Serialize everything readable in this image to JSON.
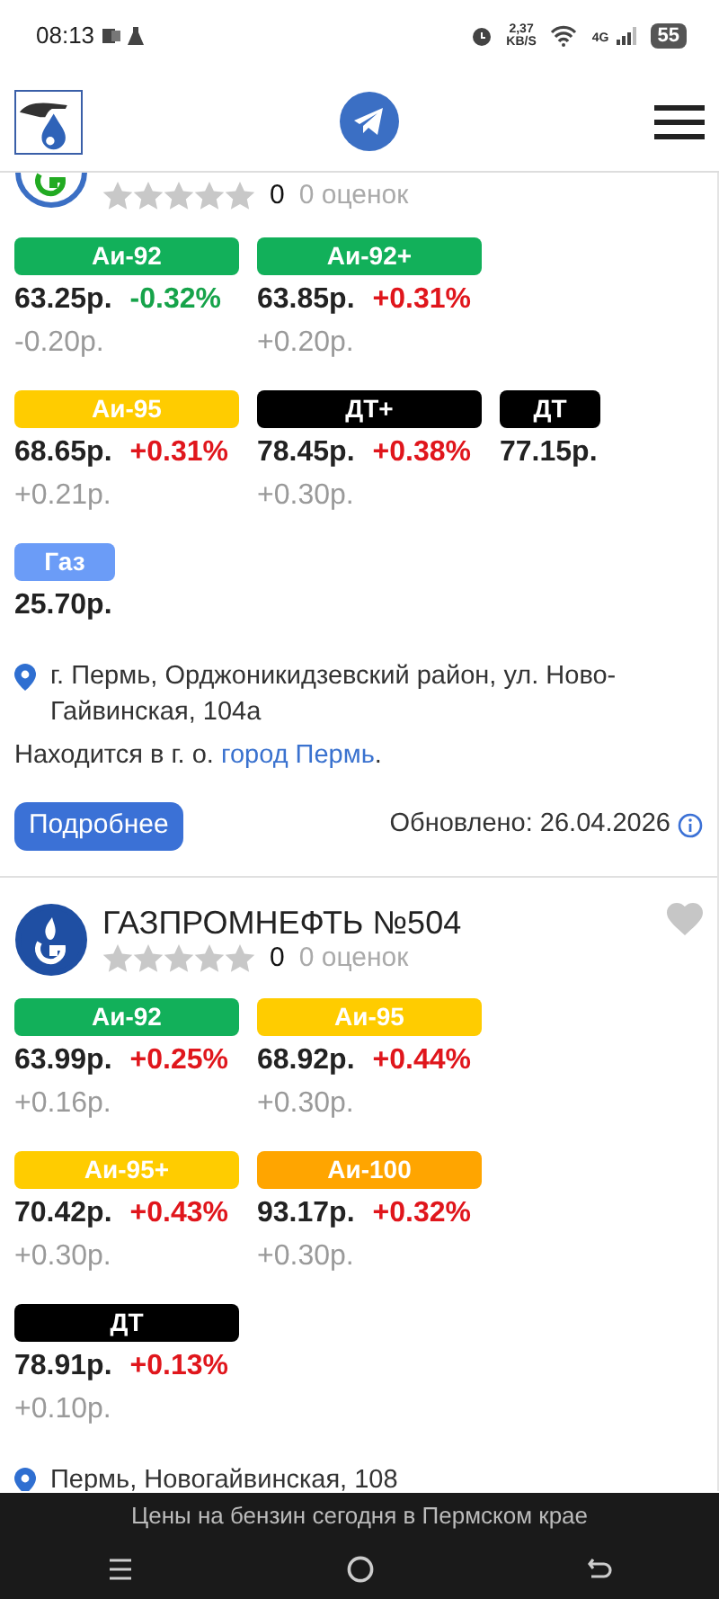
{
  "status_bar": {
    "time": "08:13",
    "net_speed_value": "2,37",
    "net_speed_unit": "KB/S",
    "network": "4G",
    "battery": "55"
  },
  "stations": [
    {
      "logo": {
        "color": "#3b6fc4"
      },
      "rating_count": "0",
      "rating_text": "0 оценок",
      "stars": 0,
      "fuels": [
        {
          "label": "Аи-92",
          "color": "#12b05a",
          "price": "63.25р.",
          "change_pct": "-0.32%",
          "increase": false,
          "change_rub": "-0.20р."
        },
        {
          "label": "Аи-92+",
          "color": "#12b05a",
          "price": "63.85р.",
          "change_pct": "+0.31%",
          "increase": true,
          "change_rub": "+0.20р."
        },
        {
          "label": "Аи-95",
          "color": "#ffcc00",
          "price": "68.65р.",
          "change_pct": "+0.31%",
          "increase": true,
          "change_rub": "+0.21р."
        },
        {
          "label": "ДТ+",
          "color": "#000000",
          "price": "78.45р.",
          "change_pct": "+0.38%",
          "increase": true,
          "change_rub": "+0.30р."
        },
        {
          "label": "ДТ",
          "color": "#000000",
          "price": "77.15р."
        },
        {
          "label": "Газ",
          "color": "#6b9cf7",
          "price": "25.70р."
        }
      ],
      "address": "г. Пермь, Орджоникидзевский район, ул. Ново-Гайвинская, 104а",
      "located_prefix": "Находится в г. о. ",
      "located_link": "город Пермь",
      "located_suffix": ".",
      "details_button": "Подробнее",
      "updated": "Обновлено: 26.04.2026"
    },
    {
      "name": "ГАЗПРОМНЕФТЬ №504",
      "logo": {
        "color": "#1f4fa3"
      },
      "rating_count": "0",
      "rating_text": "0 оценок",
      "stars": 0,
      "favorite": false,
      "fuels": [
        {
          "label": "Аи-92",
          "color": "#12b05a",
          "price": "63.99р.",
          "change_pct": "+0.25%",
          "increase": true,
          "change_rub": "+0.16р."
        },
        {
          "label": "Аи-95",
          "color": "#ffcc00",
          "price": "68.92р.",
          "change_pct": "+0.44%",
          "increase": true,
          "change_rub": "+0.30р."
        },
        {
          "label": "Аи-95+",
          "color": "#ffcc00",
          "price": "70.42р.",
          "change_pct": "+0.43%",
          "increase": true,
          "change_rub": "+0.30р."
        },
        {
          "label": "Аи-100",
          "color": "#ffa500",
          "price": "93.17р.",
          "change_pct": "+0.32%",
          "increase": true,
          "change_rub": "+0.30р."
        },
        {
          "label": "ДТ",
          "color": "#000000",
          "price": "78.91р.",
          "change_pct": "+0.13%",
          "increase": true,
          "change_rub": "+0.10р."
        }
      ],
      "address": "Пермь, Новогайвинская, 108"
    }
  ],
  "footer_caption": "Цены на бензин сегодня в Пермском крае"
}
